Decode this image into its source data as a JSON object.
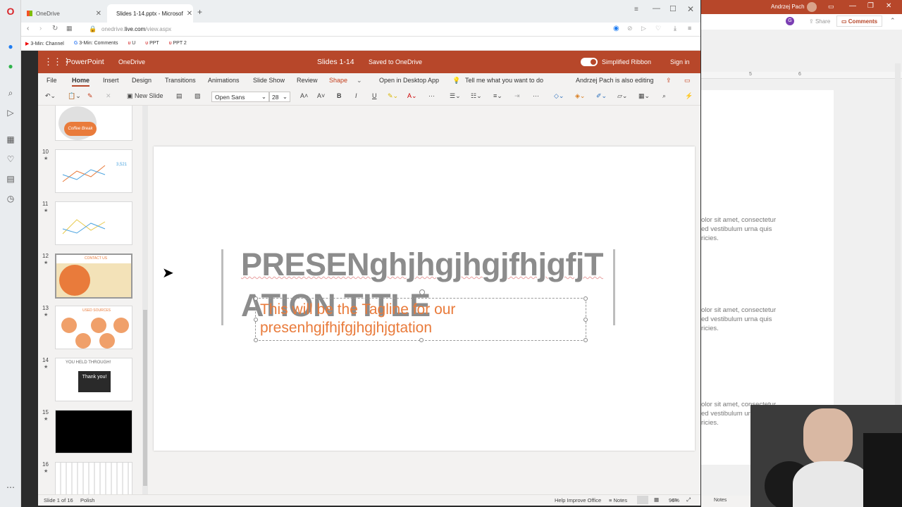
{
  "browser": {
    "tabs": [
      {
        "label": "OneDrive"
      },
      {
        "label": "Slides 1-14.pptx - Microsof"
      }
    ],
    "url_prefix": "onedrive.",
    "url_domain": "live.com",
    "url_path": "/view.aspx",
    "bookmarks": [
      "3-Min: Channel",
      "3-Min: Comments",
      "U",
      "PPT",
      "PPT 2"
    ]
  },
  "office": {
    "app": "PowerPoint",
    "service": "OneDrive",
    "doc_title": "Slides 1-14",
    "save_status": "Saved to OneDrive",
    "simplified_ribbon": "Simplified Ribbon",
    "sign_in": "Sign in"
  },
  "ribbon": {
    "tabs": [
      "File",
      "Home",
      "Insert",
      "Design",
      "Transitions",
      "Animations",
      "Slide Show",
      "Review",
      "Shape"
    ],
    "open_desktop": "Open in Desktop App",
    "tell_me": "Tell me what you want to do",
    "also_editing": "Andrzej Pach is also editing",
    "new_slide": "New Slide",
    "font_name": "Open Sans",
    "font_size": "28",
    "bold": "B",
    "italic": "I",
    "underline": "U"
  },
  "thumbnails": [
    {
      "num": "",
      "caption": "Coffee Break"
    },
    {
      "num": "10",
      "caption": "3,521"
    },
    {
      "num": "11",
      "caption": ""
    },
    {
      "num": "12",
      "caption": "CONTACT US"
    },
    {
      "num": "13",
      "caption": "USED SOURCES"
    },
    {
      "num": "14",
      "caption": "YOU HELD THROUGH!",
      "sub": "Thank you!"
    },
    {
      "num": "15",
      "caption": ""
    },
    {
      "num": "16",
      "caption": ""
    }
  ],
  "slide": {
    "title_line1": "PRESENghjhgjhgjfhjgfjT",
    "title_line2": "ATION TITLE",
    "tagline_line1": "This will be the Tagline for our",
    "tagline_line2": "presenhgjfhjfgjhgjhjgtation"
  },
  "status": {
    "slide_of": "Slide 1 of 16",
    "language": "Polish",
    "help": "Help Improve Office",
    "notes": "Notes",
    "zoom": "96%"
  },
  "background_window": {
    "author": "Andrzej Pach",
    "share": "Share",
    "comments": "Comments",
    "ruler_marks": [
      "5",
      "6"
    ],
    "lorem1": "olor sit amet, consectetur\ned vestibulum urna quis\nricies.",
    "lorem2": "olor sit amet, consectetur\ned vestibulum urna quis\nricies.",
    "lorem3": "olor sit amet, consectetur\ned vestibulum urna quis\nricies.",
    "notes": "Notes"
  },
  "colors": {
    "brand": "#b7472a",
    "accent_orange": "#e97b3b",
    "title_gray": "#8c8c8c"
  }
}
